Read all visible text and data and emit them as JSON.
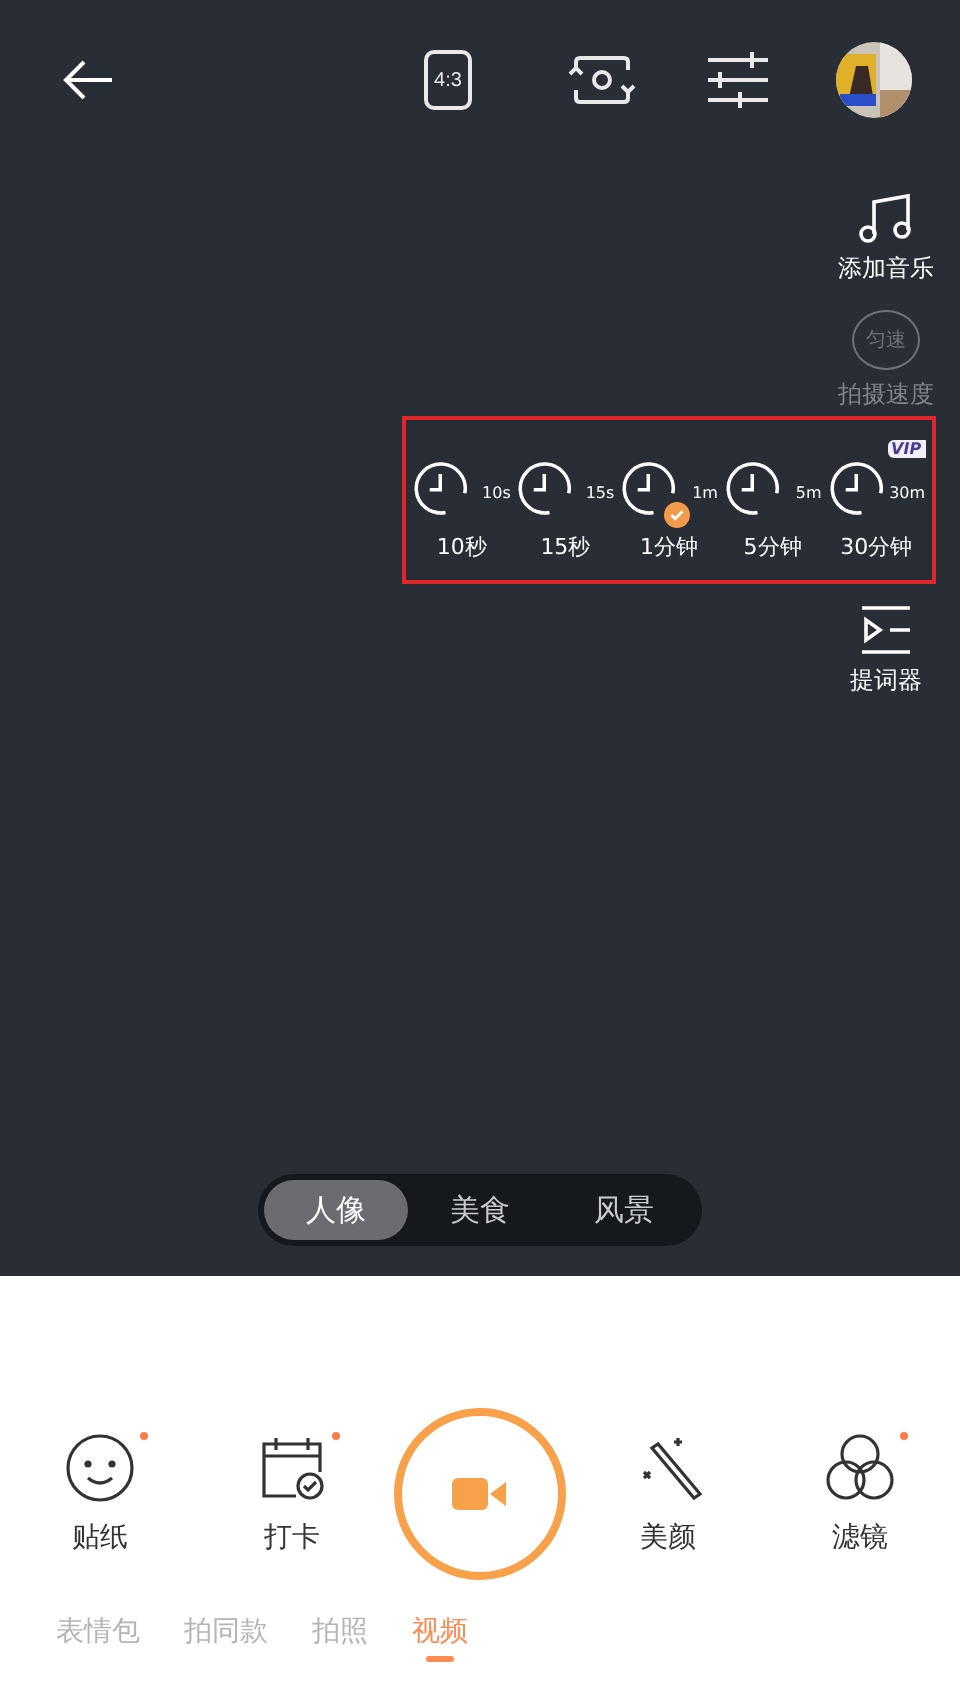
{
  "top_bar": {
    "ratio": "4:3"
  },
  "side_tools": [
    {
      "kind": "music",
      "label": "添加音乐"
    },
    {
      "kind": "speed",
      "label": "拍摄速度",
      "icon_text": "匀速"
    }
  ],
  "timer_options": [
    {
      "badge": "10s",
      "label": "10秒",
      "selected": false
    },
    {
      "badge": "15s",
      "label": "15秒",
      "selected": false
    },
    {
      "badge": "1m",
      "label": "1分钟",
      "selected": true
    },
    {
      "badge": "5m",
      "label": "5分钟",
      "selected": false
    },
    {
      "badge": "30m",
      "label": "30分钟",
      "selected": false,
      "vip_text": "VIP"
    }
  ],
  "teleprompter": {
    "label": "提词器"
  },
  "scene_tabs": [
    {
      "label": "人像",
      "selected": true
    },
    {
      "label": "美食",
      "selected": false
    },
    {
      "label": "风景",
      "selected": false
    }
  ],
  "tools_left": [
    {
      "kind": "sticker",
      "label": "贴纸",
      "dot": true
    },
    {
      "kind": "checkin",
      "label": "打卡",
      "dot": true
    }
  ],
  "tools_right": [
    {
      "kind": "beauty",
      "label": "美颜",
      "dot": false
    },
    {
      "kind": "filter",
      "label": "滤镜",
      "dot": true
    }
  ],
  "mode_tabs": [
    {
      "label": "表情包",
      "selected": false
    },
    {
      "label": "拍同款",
      "selected": false
    },
    {
      "label": "拍照",
      "selected": false
    },
    {
      "label": "视频",
      "selected": true
    }
  ]
}
